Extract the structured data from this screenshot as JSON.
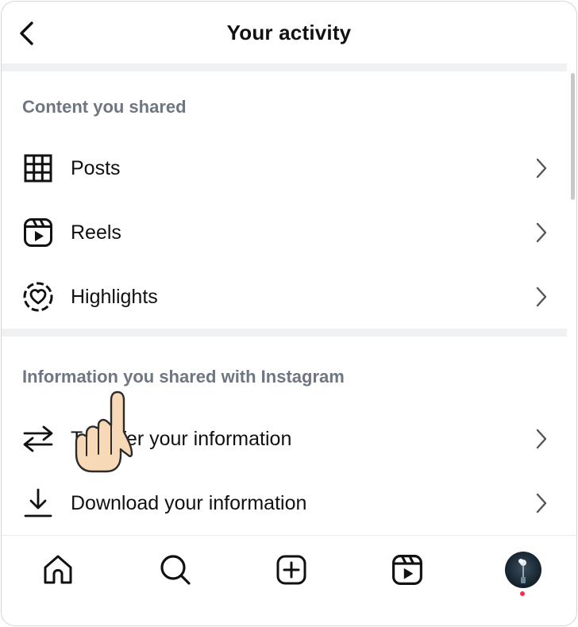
{
  "header": {
    "title": "Your activity",
    "back_icon": "chevron-left-icon"
  },
  "sections": [
    {
      "label": "Content you shared",
      "items": [
        {
          "label": "Posts",
          "icon": "grid-icon"
        },
        {
          "label": "Reels",
          "icon": "reels-icon"
        },
        {
          "label": "Highlights",
          "icon": "highlights-icon"
        }
      ]
    },
    {
      "label": "Information you shared with Instagram",
      "items": [
        {
          "label": "Transfer your information",
          "icon": "transfer-arrows-icon"
        },
        {
          "label": "Download your information",
          "icon": "download-icon"
        }
      ]
    }
  ],
  "bottom_nav": {
    "items": [
      "home-icon",
      "search-icon",
      "create-post-icon",
      "reels-icon",
      "profile-avatar"
    ],
    "notification_dot_color": "#ff2d4a"
  },
  "overlay": {
    "icon": "pointing-hand-cursor-icon",
    "fill_color": "#f7d9b8"
  }
}
